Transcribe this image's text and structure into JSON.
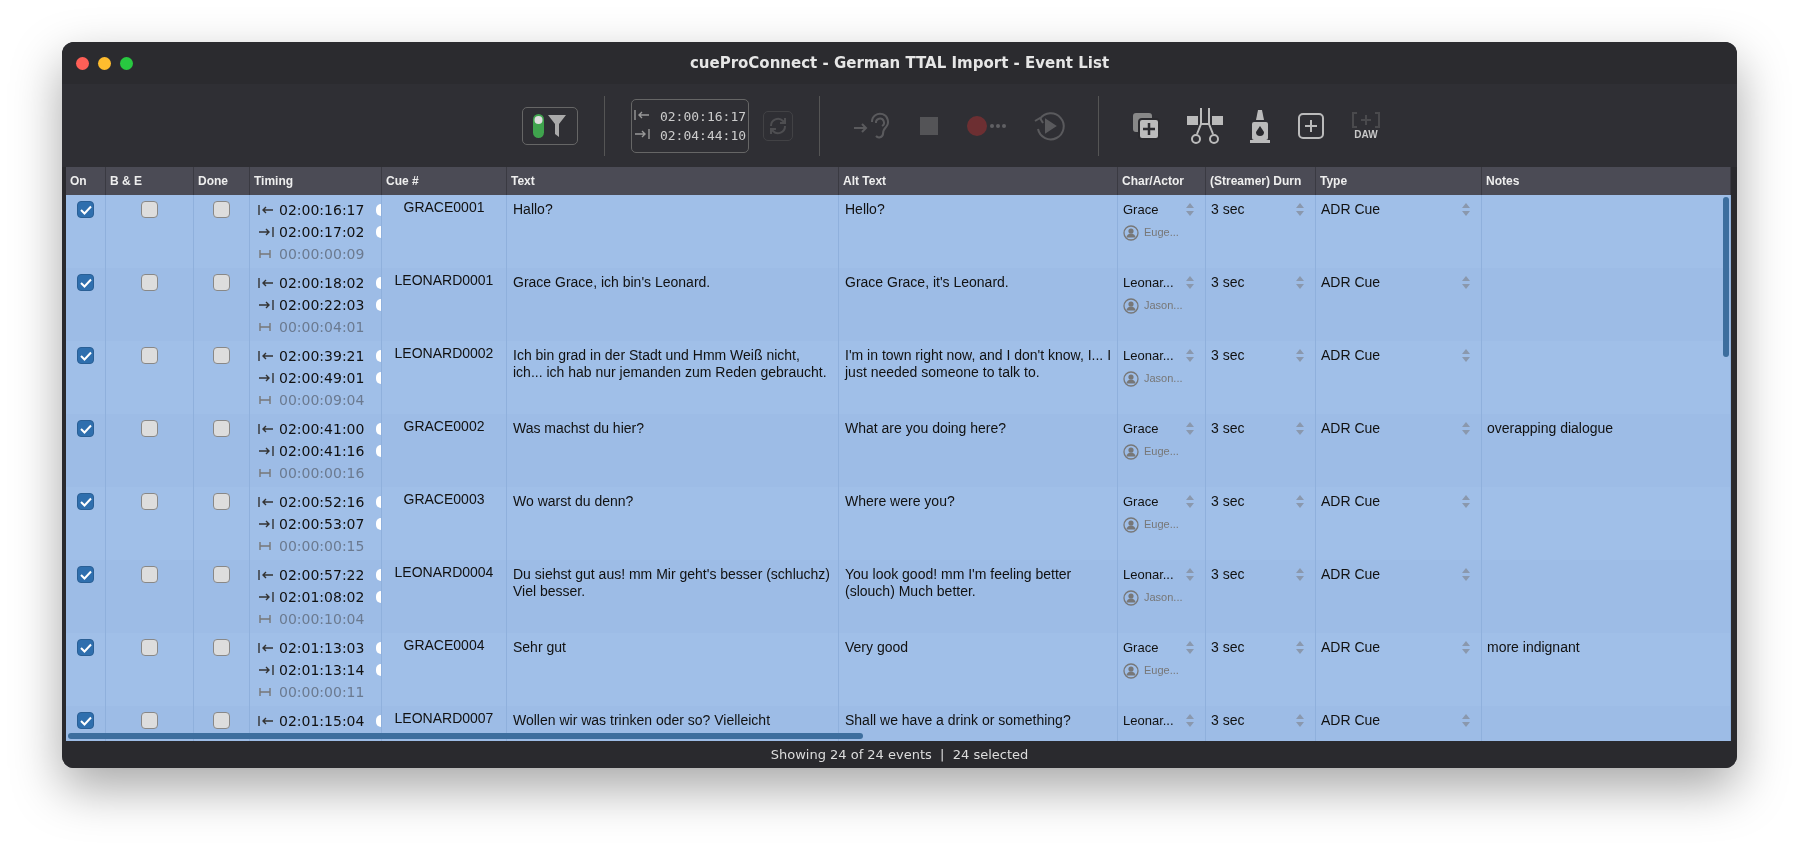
{
  "window": {
    "title": "cueProConnect - German TTAL Import - Event List"
  },
  "toolbar": {
    "filter": {
      "on": true
    },
    "timecode": {
      "in": "02:00:16:17",
      "out": "02:04:44:10"
    },
    "buttons": [
      {
        "kind": "refresh",
        "disabled": true
      },
      {
        "kind": "listen",
        "disabled": true
      },
      {
        "kind": "stop",
        "disabled": true
      },
      {
        "kind": "record",
        "disabled": true
      },
      {
        "kind": "replay",
        "disabled": true
      },
      {
        "kind": "add-copy",
        "disabled": false
      },
      {
        "kind": "cut",
        "disabled": false
      },
      {
        "kind": "ink",
        "disabled": false
      },
      {
        "kind": "add",
        "disabled": false
      },
      {
        "kind": "daw",
        "disabled": true,
        "label": "DAW"
      }
    ]
  },
  "table": {
    "columns": [
      "On",
      "B & E",
      "Done",
      "Timing",
      "Cue #",
      "Text",
      "Alt Text",
      "Char/Actor",
      "(Streamer) Durn",
      "Type",
      "Notes"
    ],
    "rows": [
      {
        "selected": true,
        "on": true,
        "be": false,
        "done": false,
        "in": "02:00:16:17",
        "out": "02:00:17:02",
        "dur": "00:00:00:09",
        "cue": "GRACE0001",
        "text": "Hallo?",
        "alt": "Hello?",
        "char": "Grace",
        "actor": "Euge...",
        "durn": "3 sec",
        "type": "ADR Cue"
      },
      {
        "selected": true,
        "on": true,
        "be": false,
        "done": false,
        "in": "02:00:18:02",
        "out": "02:00:22:03",
        "dur": "00:00:04:01",
        "cue": "LEONARD0001",
        "text": "Grace Grace, ich bin's Leonard.",
        "alt": "Grace Grace, it's Leonard.",
        "char": "Leonar...",
        "actor": "Jason...",
        "durn": "3 sec",
        "type": "ADR Cue"
      },
      {
        "selected": true,
        "on": true,
        "be": false,
        "done": false,
        "in": "02:00:39:21",
        "out": "02:00:49:01",
        "dur": "00:00:09:04",
        "cue": "LEONARD0002",
        "text": "Ich bin grad in der Stadt und Hmm Weiß nicht, ich... ich hab nur jemanden zum Reden gebraucht.",
        "alt": "I'm in town right now, and I don't know, I... I just needed someone to talk to.",
        "char": "Leonar...",
        "actor": "Jason...",
        "durn": "3 sec",
        "type": "ADR Cue"
      },
      {
        "selected": true,
        "on": true,
        "be": false,
        "done": false,
        "in": "02:00:41:00",
        "out": "02:00:41:16",
        "dur": "00:00:00:16",
        "cue": "GRACE0002",
        "text": "Was machst du hier?",
        "alt": "What are you doing here?",
        "char": "Grace",
        "actor": "Euge...",
        "durn": "3 sec",
        "type": "ADR Cue",
        "notes": "overapping dialogue"
      },
      {
        "selected": true,
        "on": true,
        "be": false,
        "done": false,
        "in": "02:00:52:16",
        "out": "02:00:53:07",
        "dur": "00:00:00:15",
        "cue": "GRACE0003",
        "text": "Wo warst du denn?",
        "alt": "Where were you?",
        "char": "Grace",
        "actor": "Euge...",
        "durn": "3 sec",
        "type": "ADR Cue"
      },
      {
        "selected": true,
        "on": true,
        "be": false,
        "done": false,
        "in": "02:00:57:22",
        "out": "02:01:08:02",
        "dur": "00:00:10:04",
        "cue": "LEONARD0004",
        "text": "Du siehst gut aus! mm Mir geht's besser (schluchz) Viel besser.",
        "alt": "You look good! mm I'm feeling better (slouch) Much better.",
        "char": "Leonar...",
        "actor": "Jason...",
        "durn": "3 sec",
        "type": "ADR Cue"
      },
      {
        "selected": true,
        "on": true,
        "be": false,
        "done": false,
        "in": "02:01:13:03",
        "out": "02:01:13:14",
        "dur": "00:00:00:11",
        "cue": "GRACE0004",
        "text": "Sehr gut",
        "alt": "Very good",
        "char": "Grace",
        "actor": "Euge...",
        "durn": "3 sec",
        "type": "ADR Cue",
        "notes": "more indignant"
      },
      {
        "selected": true,
        "on": true,
        "be": false,
        "done": false,
        "in": "02:01:15:04",
        "cue": "LEONARD0007",
        "text": "Wollen wir was trinken oder so? Vielleicht",
        "alt": "Shall we have a drink or something?",
        "char": "Leonar...",
        "durn": "3 sec",
        "type": "ADR Cue"
      }
    ]
  },
  "status_bar": "Showing 24 of 24 events  |  24 selected"
}
